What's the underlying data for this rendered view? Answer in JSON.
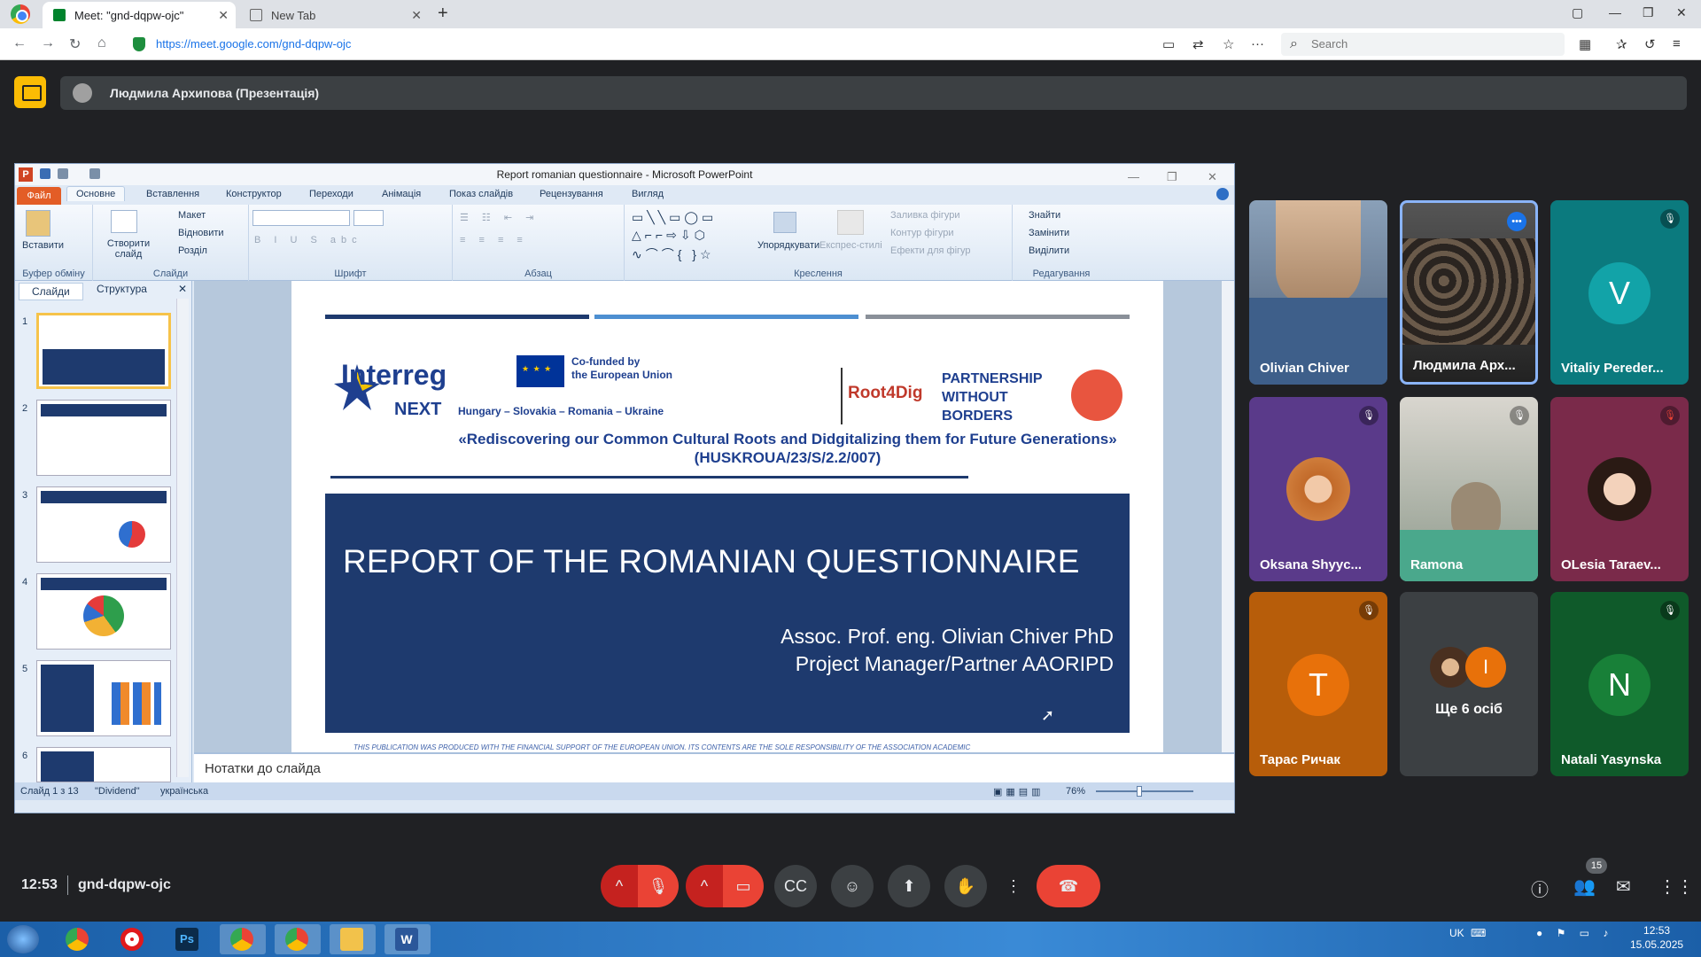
{
  "browser": {
    "tabs": [
      {
        "label": "Meet: \"gnd-dqpw-ojc\"",
        "active": true
      },
      {
        "label": "New Tab",
        "active": false
      }
    ],
    "url": "https://meet.google.com/gnd-dqpw-ojc",
    "search_placeholder": "Search"
  },
  "meet": {
    "presenter_label": "Людмила Архипова (Презентація)",
    "time": "12:53",
    "meeting_code": "gnd-dqpw-ojc",
    "participants_count": "15",
    "accent_red": "#ea4335"
  },
  "ppt": {
    "window_title": "Report romanian questionnaire - Microsoft PowerPoint",
    "file_tab": "Файл",
    "tabs": [
      "Основне",
      "Вставлення",
      "Конструктор",
      "Переходи",
      "Анімація",
      "Показ слайдів",
      "Рецензування",
      "Вигляд"
    ],
    "ribbon": {
      "paste": "Вставити",
      "clipboard": "Буфер обміну",
      "layout": "Макет",
      "reset": "Відновити",
      "new_slide": "Створити слайд",
      "section": "Розділ",
      "slides": "Слайди",
      "font": "Шрифт",
      "paragraph": "Абзац",
      "arrange": "Упорядкувати",
      "quick_styles": "Експрес-стилі",
      "shape_fill": "Заливка фігури",
      "shape_outline": "Контур фігури",
      "shape_effects": "Ефекти для фігур",
      "drawing": "Креслення",
      "find": "Знайти",
      "replace": "Замінити",
      "select": "Виділити",
      "editing": "Редагування"
    },
    "left_tabs": [
      "Слайди",
      "Структура"
    ],
    "thumb_numbers": [
      "1",
      "2",
      "3",
      "4",
      "5",
      "6"
    ],
    "slide": {
      "interreg": "Interreg",
      "next": "NEXT",
      "countries": "Hungary – Slovakia – Romania – Ukraine",
      "cofunded_1": "Co-funded by",
      "cofunded_2": "the European Union",
      "root4dig": "Root4Dig",
      "pwb_1": "PARTNERSHIP",
      "pwb_2": "WITHOUT",
      "pwb_3": "BORDERS",
      "project": "«Rediscovering our Common Cultural Roots and Didgitalizing them for Future Generations» (HUSKROUA/23/S/2.2/007)",
      "title": "REPORT OF THE ROMANIAN QUESTIONNAIRE",
      "author_1": "Assoc. Prof. eng. Olivian Chiver PhD",
      "author_2": "Project Manager/Partner AAORIPD",
      "footer": "THIS PUBLICATION WAS PRODUCED WITH THE FINANCIAL SUPPORT OF THE EUROPEAN UNION. ITS CONTENTS ARE THE SOLE RESPONSIBILITY OF THE ASSOCIATION ACADEMIC"
    },
    "notes_placeholder": "Нотатки до слайда",
    "status": {
      "slide_of": "Слайд 1 з 13",
      "theme": "\"Dividend\"",
      "language": "українська",
      "zoom": "76%"
    }
  },
  "participants": [
    {
      "name": "Olivian Chiver",
      "muted": false
    },
    {
      "name": "Людмила Арх...",
      "muted": false
    },
    {
      "name": "Vitaliy Pereder...",
      "muted": true,
      "initial": "V",
      "color": "#12a3a8"
    },
    {
      "name": "Oksana Shyyc...",
      "muted": true
    },
    {
      "name": "Ramona",
      "muted": true
    },
    {
      "name": "OLesia Taraev...",
      "muted": true
    },
    {
      "name": "Тарас Ричак",
      "muted": true,
      "initial": "T",
      "color": "#e8710a"
    },
    {
      "name": "Ще 6 осіб",
      "initial": "I",
      "color": "#e8710a"
    },
    {
      "name": "Natali Yasynska",
      "muted": true,
      "initial": "N",
      "color": "#188038"
    }
  ],
  "taskbar": {
    "lang": "UK",
    "time": "12:53",
    "date": "15.05.2025"
  }
}
